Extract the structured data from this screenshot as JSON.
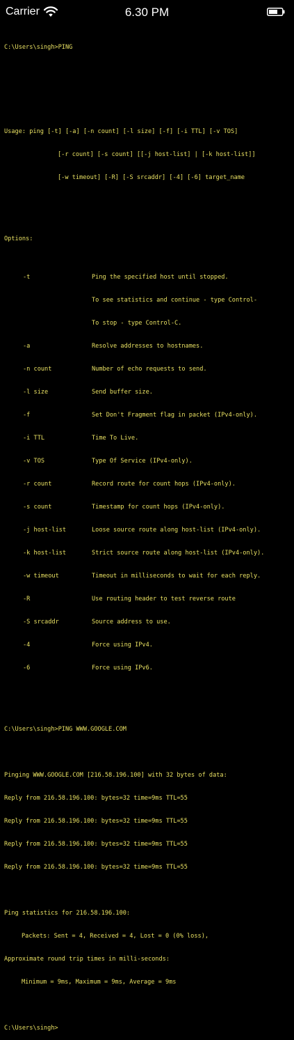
{
  "status_bar": {
    "carrier": "Carrier",
    "time": "6.30 PM",
    "wifi_icon": "wifi-icon",
    "battery_icon": "battery-icon"
  },
  "terminal": {
    "prompt1": "C:\\Users\\singh>PING",
    "usage": [
      "Usage: ping [-t] [-a] [-n count] [-l size] [-f] [-i TTL] [-v TOS]",
      "[-r count] [-s count] [[-j host-list] | [-k host-list]]",
      "[-w timeout] [-R] [-S srcaddr] [-4] [-6] target_name"
    ],
    "options_header": "Options:",
    "options": [
      {
        "flag": "-t",
        "desc": "Ping the specified host until stopped."
      },
      {
        "flag": "",
        "desc": "To see statistics and continue - type Control-"
      },
      {
        "flag": "",
        "desc": "To stop - type Control-C."
      },
      {
        "flag": "-a",
        "desc": "Resolve addresses to hostnames."
      },
      {
        "flag": "-n count",
        "desc": "Number of echo requests to send."
      },
      {
        "flag": "-l size",
        "desc": "Send buffer size."
      },
      {
        "flag": "-f",
        "desc": "Set Don't Fragment flag in packet (IPv4-only)."
      },
      {
        "flag": "-i TTL",
        "desc": "Time To Live."
      },
      {
        "flag": "-v TOS",
        "desc": "Type Of Service (IPv4-only)."
      },
      {
        "flag": "-r count",
        "desc": "Record route for count hops (IPv4-only)."
      },
      {
        "flag": "-s count",
        "desc": "Timestamp for count hops (IPv4-only)."
      },
      {
        "flag": "-j host-list",
        "desc": "Loose source route along host-list (IPv4-only)."
      },
      {
        "flag": "-k host-list",
        "desc": "Strict source route along host-list (IPv4-only)."
      },
      {
        "flag": "-w timeout",
        "desc": "Timeout in milliseconds to wait for each reply."
      },
      {
        "flag": "-R",
        "desc": "Use routing header to test reverse route"
      },
      {
        "flag": "-S srcaddr",
        "desc": "Source address to use."
      },
      {
        "flag": "-4",
        "desc": "Force using IPv4."
      },
      {
        "flag": "-6",
        "desc": "Force using IPv6."
      }
    ],
    "prompt2": "C:\\Users\\singh>PING WWW.GOOGLE.COM",
    "pinging": "Pinging WWW.GOOGLE.COM [216.58.196.100] with 32 bytes of data:",
    "replies": [
      "Reply from 216.58.196.100: bytes=32 time=9ms TTL=55",
      "Reply from 216.58.196.100: bytes=32 time=9ms TTL=55",
      "Reply from 216.58.196.100: bytes=32 time=9ms TTL=55",
      "Reply from 216.58.196.100: bytes=32 time=9ms TTL=55"
    ],
    "stats_header": "Ping statistics for 216.58.196.100:",
    "packets": "Packets: Sent = 4, Received = 4, Lost = 0 (0% loss),",
    "rtt_header": "Approximate round trip times in milli-seconds:",
    "rtt": "Minimum = 9ms, Maximum = 9ms, Average = 9ms",
    "prompt3": "C:\\Users\\singh>"
  },
  "colors": {
    "background": "#000000",
    "terminal_text": "#e8e062",
    "status_text": "#ffffff"
  }
}
